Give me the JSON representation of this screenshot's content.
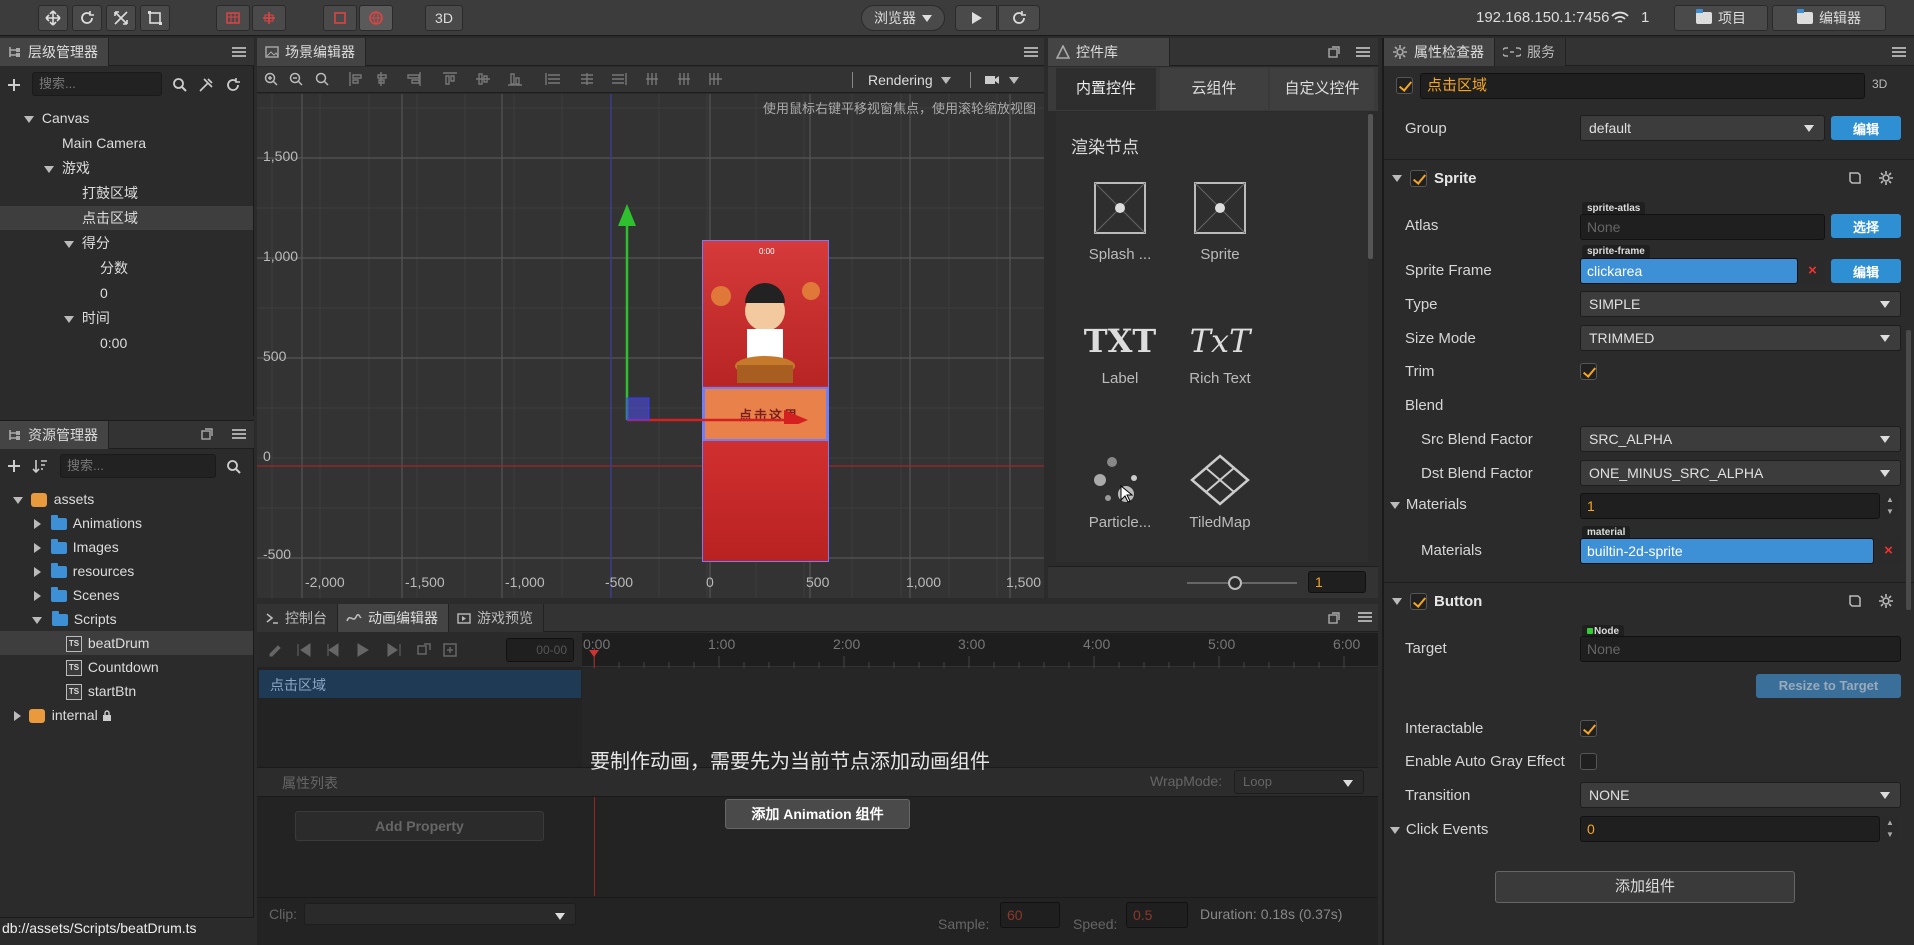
{
  "toolbar": {
    "browser_label": "浏览器",
    "mode_3d": "3D",
    "ip_address": "192.168.150.1:7456",
    "wifi_count": "1",
    "project_label": "项目",
    "editor_label": "编辑器"
  },
  "hierarchy": {
    "title": "层级管理器",
    "search_placeholder": "搜索...",
    "nodes": [
      "Canvas",
      "Main Camera",
      "游戏",
      "打鼓区域",
      "点击区域",
      "得分",
      "分数",
      "0",
      "时间",
      "0:00"
    ]
  },
  "assets": {
    "title": "资源管理器",
    "search_placeholder": "搜索...",
    "items": [
      "assets",
      "Animations",
      "Images",
      "resources",
      "Scenes",
      "Scripts",
      "beatDrum",
      "Countdown",
      "startBtn",
      "internal"
    ],
    "ts_badge": "TS",
    "status_path": "db://assets/Scripts/beatDrum.ts"
  },
  "scene": {
    "title": "场景编辑器",
    "rendering_label": "Rendering",
    "hint": "使用鼠标右键平移视窗焦点，使用滚轮缩放视图",
    "y_ticks": [
      "1,500",
      "1,000",
      "500",
      "0",
      "-500"
    ],
    "x_ticks": [
      "-2,000",
      "-1,500",
      "-1,000",
      "-500",
      "0",
      "500",
      "1,000",
      "1,500"
    ],
    "game_score": "0:00",
    "game_text": "点击这里"
  },
  "library": {
    "title": "控件库",
    "tabs": [
      "内置控件",
      "云组件",
      "自定义控件"
    ],
    "section": "渲染节点",
    "widgets": [
      "Splash ...",
      "Sprite",
      "Label",
      "Rich Text",
      "Particle...",
      "TiledMap"
    ],
    "txt_glyph": "TXT",
    "txt_glyph2": "TxT",
    "zoom_value": "1"
  },
  "bottom": {
    "tabs": [
      "控制台",
      "动画编辑器",
      "游戏预览"
    ],
    "time_input": "00-00",
    "time_marks": [
      "0:00",
      "1:00",
      "2:00",
      "3:00",
      "4:00",
      "5:00",
      "6:00"
    ],
    "node_row": "点击区域",
    "message": "要制作动画，需要先为当前节点添加动画组件",
    "prop_list": "属性列表",
    "wrapmode_label": "WrapMode:",
    "wrapmode_value": "Loop",
    "add_property": "Add Property",
    "add_animation": "添加 Animation 组件",
    "clip_label": "Clip:",
    "sample_label": "Sample:",
    "sample_value": "60",
    "speed_label": "Speed:",
    "speed_value": "0.5",
    "duration": "Duration: 0.18s (0.37s)"
  },
  "inspector": {
    "title": "属性检查器",
    "tab_service": "服务",
    "node_name": "点击区域",
    "badge_3d": "3D",
    "group_label": "Group",
    "group_value": "default",
    "edit_btn": "编辑",
    "sprite_title": "Sprite",
    "atlas_label": "Atlas",
    "atlas_tag": "sprite-atlas",
    "atlas_value": "None",
    "select_btn": "选择",
    "frame_label": "Sprite Frame",
    "frame_tag": "sprite-frame",
    "frame_value": "clickarea",
    "type_label": "Type",
    "type_value": "SIMPLE",
    "size_label": "Size Mode",
    "size_value": "TRIMMED",
    "trim_label": "Trim",
    "blend_label": "Blend",
    "src_label": "Src Blend Factor",
    "src_value": "SRC_ALPHA",
    "dst_label": "Dst Blend Factor",
    "dst_value": "ONE_MINUS_SRC_ALPHA",
    "materials_label": "Materials",
    "materials_count": "1",
    "material_tag": "material",
    "material_value": "builtin-2d-sprite",
    "button_title": "Button",
    "target_label": "Target",
    "node_tag": "Node",
    "target_value": "None",
    "resize_btn": "Resize to Target",
    "interactable_label": "Interactable",
    "gray_label": "Enable Auto Gray Effect",
    "transition_label": "Transition",
    "transition_value": "NONE",
    "click_label": "Click Events",
    "click_value": "0",
    "add_component": "添加组件"
  },
  "colors": {
    "accent_orange": "#f5a623",
    "select_blue": "#2f8fd3",
    "panel_bg": "#2b2b2b"
  }
}
